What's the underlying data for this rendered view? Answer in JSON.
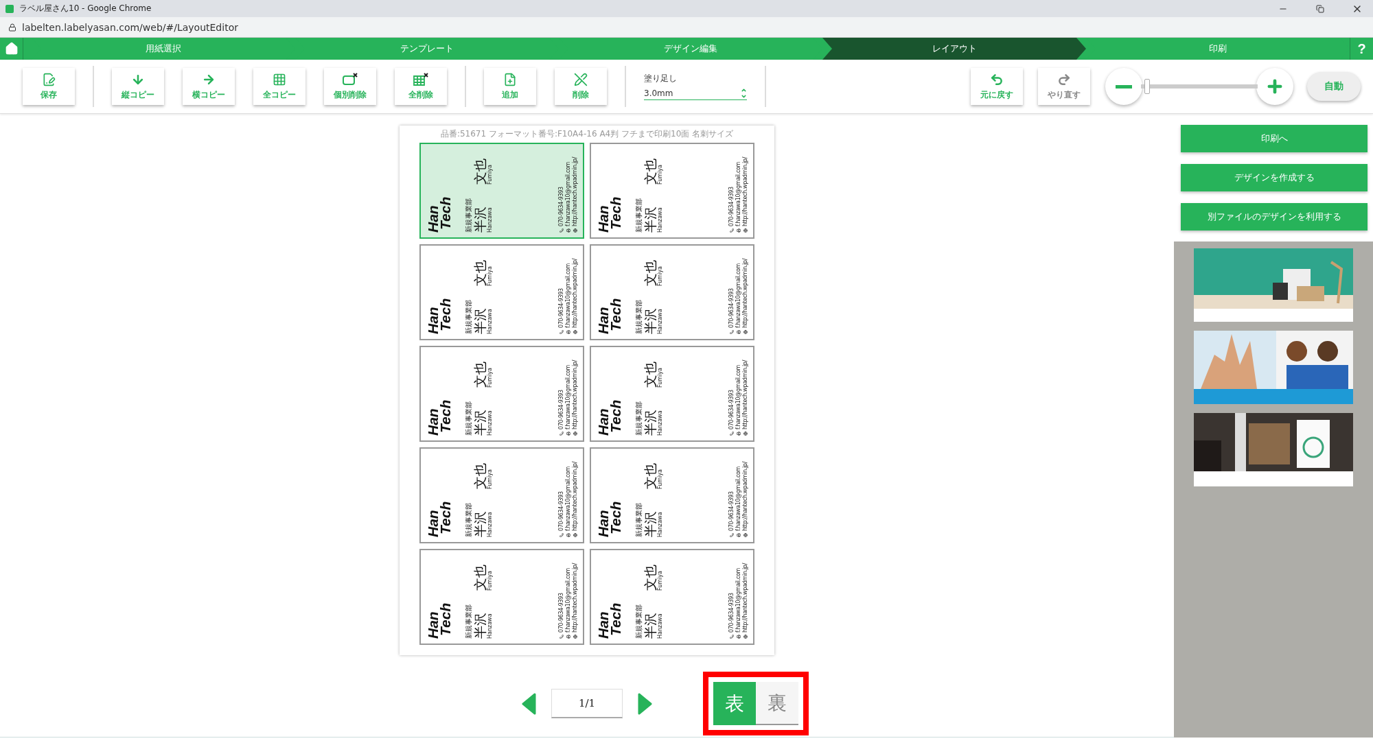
{
  "browser": {
    "tab_title": "ラベル屋さん10 - Google Chrome",
    "url": "labelten.labelyasan.com/web/#/LayoutEditor"
  },
  "steps": [
    {
      "label": "用紙選択",
      "selected": false
    },
    {
      "label": "テンプレート",
      "selected": false
    },
    {
      "label": "デザイン編集",
      "selected": false
    },
    {
      "label": "レイアウト",
      "selected": true
    },
    {
      "label": "印刷",
      "selected": false
    }
  ],
  "help": "?",
  "toolbar": {
    "groups": [
      [
        {
          "label": "保存"
        }
      ],
      [
        {
          "label": "縦コピー"
        },
        {
          "label": "横コピー"
        },
        {
          "label": "全コピー"
        },
        {
          "label": "個別削除"
        },
        {
          "label": "全削除"
        }
      ],
      [
        {
          "label": "追加"
        },
        {
          "label": "削除"
        }
      ]
    ],
    "bleed": {
      "label": "塗り足し",
      "value": "3.0mm"
    },
    "history": [
      {
        "label": "元に戻す",
        "disabled": false
      },
      {
        "label": "やり直す",
        "disabled": true
      }
    ],
    "zoom": {
      "level": 0.05
    },
    "auto": "自動"
  },
  "sheet": {
    "caption": "品番:51671 フォーマット番号:F10A4-16 A4判 フチまで印刷10面 名刺サイズ",
    "cards": [
      {
        "selected": true,
        "logo": [
          "Han",
          "Tech"
        ],
        "dept": "新規事業部",
        "surname": "半沢",
        "given": "文也",
        "surname_roman": "Hanzawa",
        "given_roman": "Fumiya",
        "phone": "070-9634-9393",
        "email": "f.hanzawa10@gmail.com",
        "url": "http://hantech.wpadmin.jp/"
      },
      {
        "selected": false,
        "logo": [
          "Han",
          "Tech"
        ],
        "dept": "新規事業部",
        "surname": "半沢",
        "given": "文也",
        "surname_roman": "Hanzawa",
        "given_roman": "Fumiya",
        "phone": "070-9634-9393",
        "email": "f.hanzawa10@gmail.com",
        "url": "http://hantech.wpadmin.jp/"
      },
      {
        "selected": false,
        "logo": [
          "Han",
          "Tech"
        ],
        "dept": "新規事業部",
        "surname": "半沢",
        "given": "文也",
        "surname_roman": "Hanzawa",
        "given_roman": "Fumiya",
        "phone": "070-9634-9393",
        "email": "f.hanzawa10@gmail.com",
        "url": "http://hantech.wpadmin.jp/"
      },
      {
        "selected": false,
        "logo": [
          "Han",
          "Tech"
        ],
        "dept": "新規事業部",
        "surname": "半沢",
        "given": "文也",
        "surname_roman": "Hanzawa",
        "given_roman": "Fumiya",
        "phone": "070-9634-9393",
        "email": "f.hanzawa10@gmail.com",
        "url": "http://hantech.wpadmin.jp/"
      },
      {
        "selected": false,
        "logo": [
          "Han",
          "Tech"
        ],
        "dept": "新規事業部",
        "surname": "半沢",
        "given": "文也",
        "surname_roman": "Hanzawa",
        "given_roman": "Fumiya",
        "phone": "070-9634-9393",
        "email": "f.hanzawa10@gmail.com",
        "url": "http://hantech.wpadmin.jp/"
      },
      {
        "selected": false,
        "logo": [
          "Han",
          "Tech"
        ],
        "dept": "新規事業部",
        "surname": "半沢",
        "given": "文也",
        "surname_roman": "Hanzawa",
        "given_roman": "Fumiya",
        "phone": "070-9634-9393",
        "email": "f.hanzawa10@gmail.com",
        "url": "http://hantech.wpadmin.jp/"
      },
      {
        "selected": false,
        "logo": [
          "Han",
          "Tech"
        ],
        "dept": "新規事業部",
        "surname": "半沢",
        "given": "文也",
        "surname_roman": "Hanzawa",
        "given_roman": "Fumiya",
        "phone": "070-9634-9393",
        "email": "f.hanzawa10@gmail.com",
        "url": "http://hantech.wpadmin.jp/"
      },
      {
        "selected": false,
        "logo": [
          "Han",
          "Tech"
        ],
        "dept": "新規事業部",
        "surname": "半沢",
        "given": "文也",
        "surname_roman": "Hanzawa",
        "given_roman": "Fumiya",
        "phone": "070-9634-9393",
        "email": "f.hanzawa10@gmail.com",
        "url": "http://hantech.wpadmin.jp/"
      },
      {
        "selected": false,
        "logo": [
          "Han",
          "Tech"
        ],
        "dept": "新規事業部",
        "surname": "半沢",
        "given": "文也",
        "surname_roman": "Hanzawa",
        "given_roman": "Fumiya",
        "phone": "070-9634-9393",
        "email": "f.hanzawa10@gmail.com",
        "url": "http://hantech.wpadmin.jp/"
      },
      {
        "selected": false,
        "logo": [
          "Han",
          "Tech"
        ],
        "dept": "新規事業部",
        "surname": "半沢",
        "given": "文也",
        "surname_roman": "Hanzawa",
        "given_roman": "Fumiya",
        "phone": "070-9634-9393",
        "email": "f.hanzawa10@gmail.com",
        "url": "http://hantech.wpadmin.jp/"
      }
    ]
  },
  "pager": {
    "page": "1/1"
  },
  "side_toggle": {
    "highlighted": true,
    "options": [
      {
        "label": "表",
        "selected": true
      },
      {
        "label": "裏",
        "selected": false
      }
    ]
  },
  "sidebar": {
    "buttons": [
      "印刷へ",
      "デザインを作成する",
      "別ファイルのデザインを利用する"
    ]
  }
}
